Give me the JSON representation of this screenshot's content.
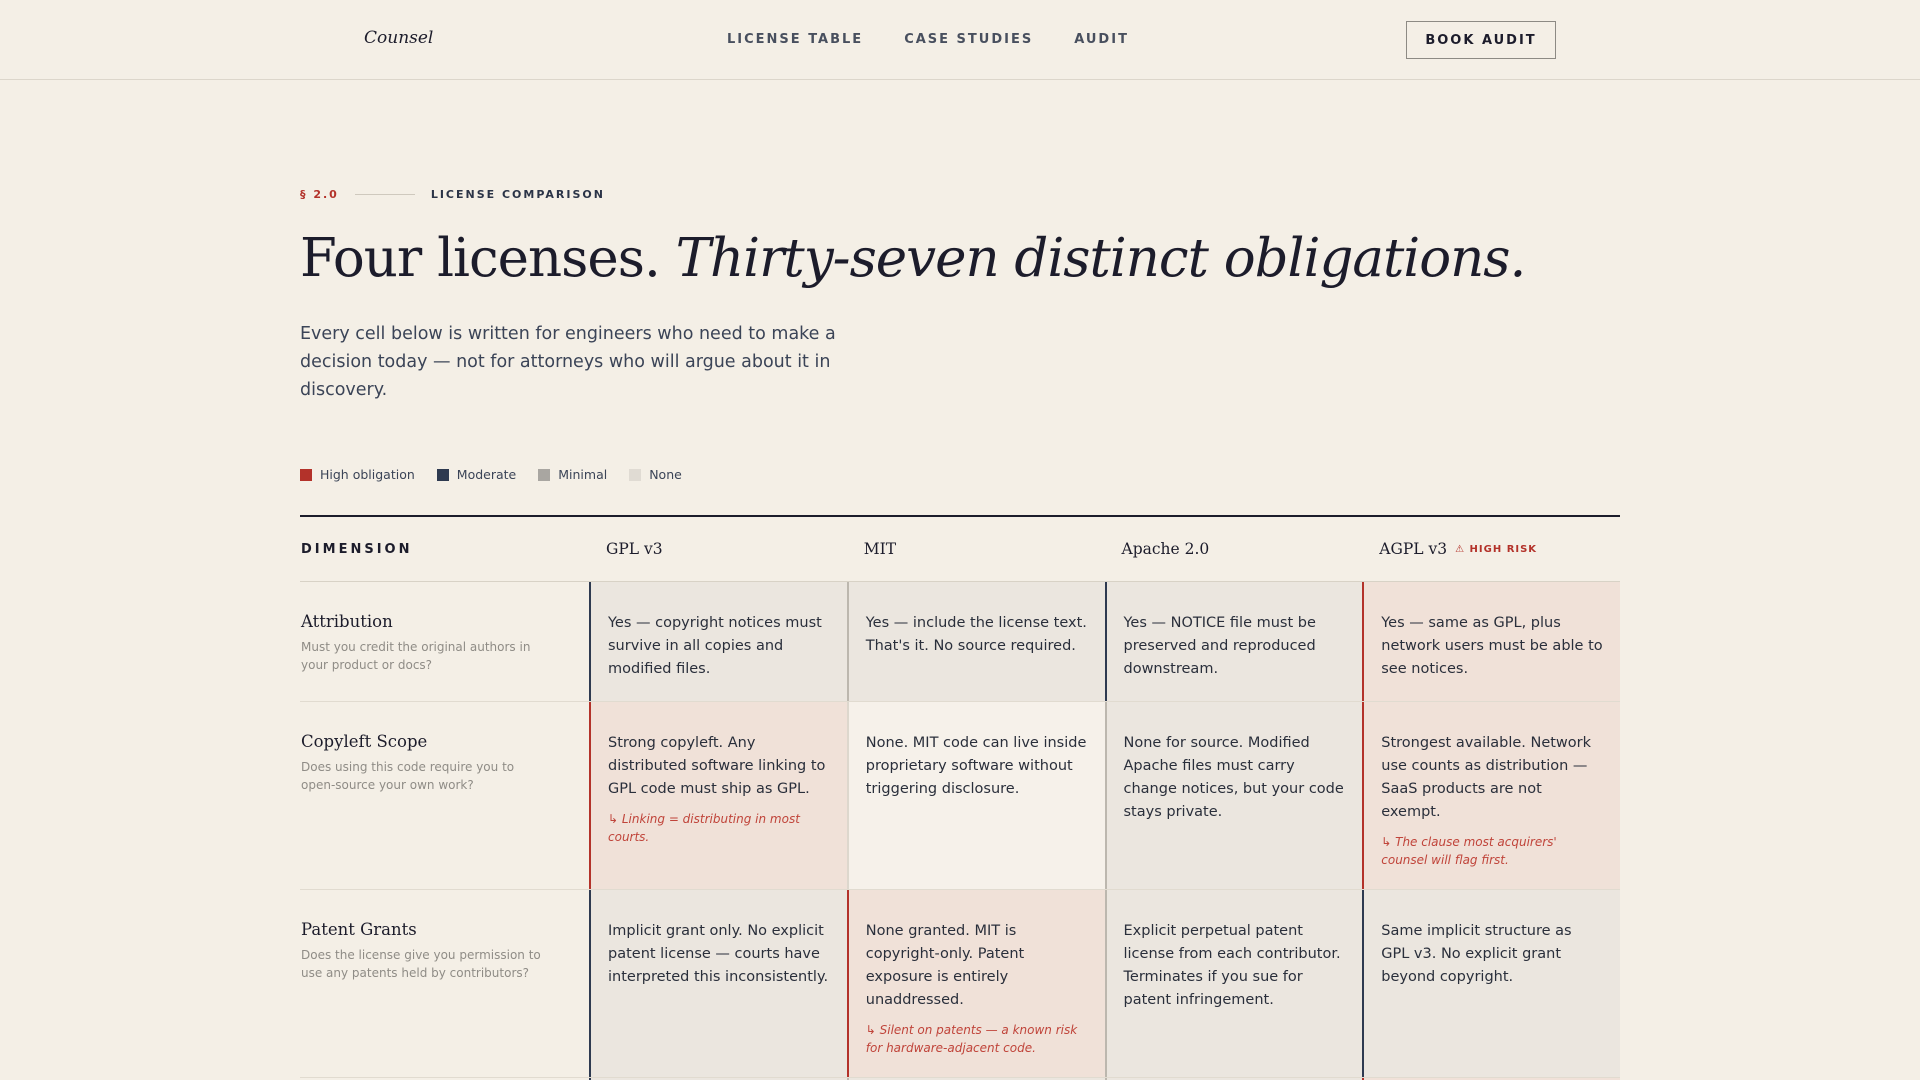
{
  "brand": {
    "logo": "Counsel"
  },
  "nav": {
    "items": [
      "LICENSE TABLE",
      "CASE STUDIES",
      "AUDIT"
    ],
    "cta": "BOOK AUDIT"
  },
  "intro": {
    "section_num": "§ 2.0",
    "section_label": "LICENSE COMPARISON",
    "headline_plain": "Four licenses. ",
    "headline_italic": "Thirty-seven distinct obligations.",
    "lede": "Every cell below is written for engineers who need to make a decision today — not for attorneys who will argue about it in discovery."
  },
  "legend": [
    {
      "label": "High obligation",
      "color": "#b3322a"
    },
    {
      "label": "Moderate",
      "color": "#2e3a50"
    },
    {
      "label": "Minimal",
      "color": "#a9a6a1"
    },
    {
      "label": "None",
      "color": "#e0dbd3"
    }
  ],
  "table": {
    "dimension_header": "DIMENSION",
    "columns": [
      {
        "name": "GPL v3",
        "badge": ""
      },
      {
        "name": "MIT",
        "badge": ""
      },
      {
        "name": "Apache 2.0",
        "badge": ""
      },
      {
        "name": "AGPL v3",
        "badge": "⚠ HIGH RISK"
      }
    ],
    "rows": [
      {
        "name": "Attribution",
        "desc": "Must you credit the original authors in your product or docs?",
        "cells": [
          {
            "level": "mod",
            "text": "Yes — copyright notices must survive in all copies and modified files.",
            "note": ""
          },
          {
            "level": "min",
            "text": "Yes — include the license text. That's it. No source required.",
            "note": ""
          },
          {
            "level": "mod",
            "text": "Yes — NOTICE file must be preserved and reproduced downstream.",
            "note": ""
          },
          {
            "level": "high",
            "text": "Yes — same as GPL, plus network users must be able to see notices.",
            "note": ""
          }
        ]
      },
      {
        "name": "Copyleft Scope",
        "desc": "Does using this code require you to open-source your own work?",
        "cells": [
          {
            "level": "high",
            "text": "Strong copyleft. Any distributed software linking to GPL code must ship as GPL.",
            "note": "↳ Linking = distributing in most courts."
          },
          {
            "level": "none",
            "text": "None. MIT code can live inside proprietary software without triggering disclosure.",
            "note": ""
          },
          {
            "level": "min",
            "text": "None for source. Modified Apache files must carry change notices, but your code stays private.",
            "note": ""
          },
          {
            "level": "high",
            "text": "Strongest available. Network use counts as distribution — SaaS products are not exempt.",
            "note": "↳ The clause most acquirers' counsel will flag first."
          }
        ]
      },
      {
        "name": "Patent Grants",
        "desc": "Does the license give you permission to use any patents held by contributors?",
        "cells": [
          {
            "level": "mod",
            "text": "Implicit grant only. No explicit patent license — courts have interpreted this inconsistently.",
            "note": ""
          },
          {
            "level": "high",
            "text": "None granted. MIT is copyright-only. Patent exposure is entirely unaddressed.",
            "note": "↳ Silent on patents — a known risk for hardware-adjacent code."
          },
          {
            "level": "min",
            "text": "Explicit perpetual patent license from each contributor. Terminates if you sue for patent infringement.",
            "note": ""
          },
          {
            "level": "mod",
            "text": "Same implicit structure as GPL v3. No explicit grant beyond copyright.",
            "note": ""
          }
        ]
      },
      {
        "name": "",
        "desc": "",
        "cells": [
          {
            "level": "mod",
            "text": "",
            "note": ""
          },
          {
            "level": "min",
            "text": "",
            "note": ""
          },
          {
            "level": "min",
            "text": "",
            "note": ""
          },
          {
            "level": "high",
            "text": "",
            "note": ""
          }
        ]
      }
    ]
  }
}
